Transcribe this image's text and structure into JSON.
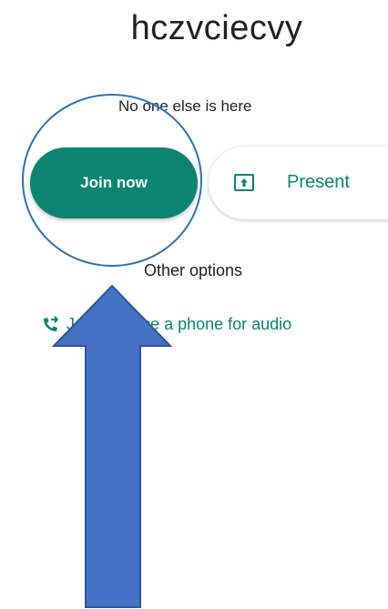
{
  "meeting": {
    "title": "hczvciecvy",
    "status": "No one else is here"
  },
  "actions": {
    "join_label": "Join now",
    "present_label": "Present"
  },
  "other_options": {
    "heading": "Other options",
    "phone_label": "Join and use a phone for audio"
  },
  "colors": {
    "accent": "#0b8571",
    "annotation_blue": "#4472c4",
    "annotation_outline": "#2f71b5"
  },
  "icons": {
    "present": "present-to-all-icon",
    "phone": "phone-forwarded-icon"
  }
}
